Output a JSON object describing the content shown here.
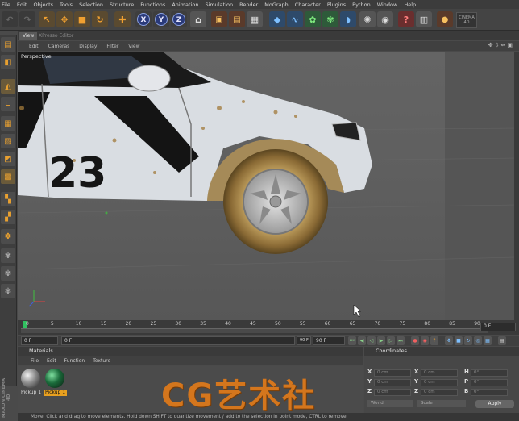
{
  "menubar": [
    "File",
    "Edit",
    "Objects",
    "Tools",
    "Selection",
    "Structure",
    "Functions",
    "Animation",
    "Simulation",
    "Render",
    "MoGraph",
    "Character",
    "Plugins",
    "Python",
    "Window",
    "Help"
  ],
  "toolbar": {
    "axis_x": "X",
    "axis_y": "Y",
    "axis_z": "Z",
    "logo_text": "CINEMA 4D"
  },
  "viewport": {
    "tabs": [
      "View",
      "XPresso Editor"
    ],
    "menu": [
      "Edit",
      "Cameras",
      "Display",
      "Filter",
      "View"
    ],
    "camera_label": "Perspective",
    "car_number": "23"
  },
  "timeline": {
    "ticks": [
      "0",
      "5",
      "10",
      "15",
      "20",
      "25",
      "30",
      "35",
      "40",
      "45",
      "50",
      "55",
      "60",
      "65",
      "70",
      "75",
      "80",
      "85",
      "90"
    ],
    "current_frame": "0 F"
  },
  "transport": {
    "start": "0 F",
    "range_start": "0 F",
    "range_end": "90 F",
    "end": "90 F"
  },
  "materials": {
    "title": "Materials",
    "menu": [
      "File",
      "Edit",
      "Function",
      "Texture"
    ],
    "items": [
      {
        "name": "Pickup 1",
        "selected": false
      },
      {
        "name": "Pickup 1",
        "selected": true
      }
    ]
  },
  "coordinates": {
    "title": "Coordinates",
    "rows": [
      {
        "a": "X",
        "av": "0 cm",
        "b": "X",
        "bv": "0 cm",
        "c": "H",
        "cv": "0°"
      },
      {
        "a": "Y",
        "av": "0 cm",
        "b": "Y",
        "bv": "0 cm",
        "c": "P",
        "cv": "0°"
      },
      {
        "a": "Z",
        "av": "0 cm",
        "b": "Z",
        "bv": "0 cm",
        "c": "B",
        "cv": "0°"
      }
    ],
    "mode": "World",
    "size_mode": "Scale",
    "apply": "Apply"
  },
  "status": "Move: Click and drag to move elements. Hold down SHIFT to quantize movement / add to the selection in point mode, CTRL to remove.",
  "watermark": "CG艺术社",
  "brand": "MAXON CINEMA 4D"
}
